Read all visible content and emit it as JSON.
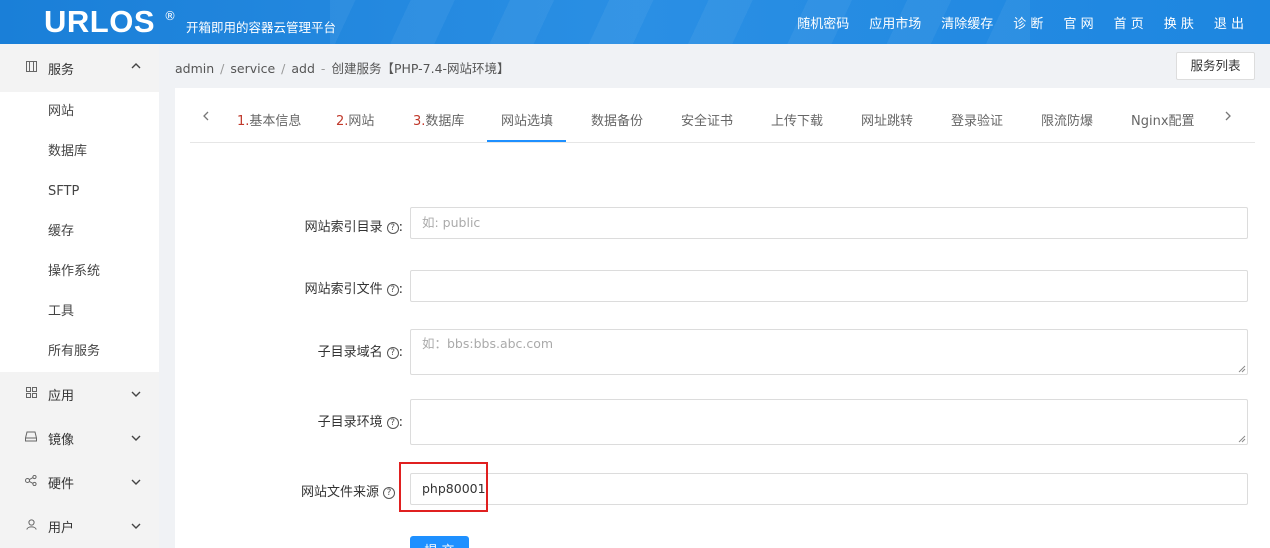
{
  "header": {
    "logo": "URLOS",
    "logo_mark": "®",
    "slogan": "开箱即用的容器云管理平台",
    "nav": [
      "随机密码",
      "应用市场",
      "清除缓存",
      "诊 断",
      "官 网",
      "首 页",
      "换 肤",
      "退 出"
    ]
  },
  "sidebar": {
    "service_group": {
      "label": "服务",
      "icon": "grid-icon",
      "expanded": true
    },
    "service_items": [
      "网站",
      "数据库",
      "SFTP",
      "缓存",
      "操作系统",
      "工具",
      "所有服务"
    ],
    "other_groups": [
      {
        "label": "应用",
        "icon": "apps-icon"
      },
      {
        "label": "镜像",
        "icon": "disk-icon"
      },
      {
        "label": "硬件",
        "icon": "share-icon"
      },
      {
        "label": "用户",
        "icon": "user-icon"
      }
    ]
  },
  "breadcrumb": {
    "parts": [
      "admin",
      "service",
      "add"
    ],
    "title": "创建服务【PHP-7.4-网站环境】"
  },
  "service_list_button": "服务列表",
  "tabs": [
    {
      "num": "1.",
      "label": "基本信息"
    },
    {
      "num": "2.",
      "label": "网站"
    },
    {
      "num": "3.",
      "label": "数据库"
    },
    {
      "num": "",
      "label": "网站选填"
    },
    {
      "num": "",
      "label": "数据备份"
    },
    {
      "num": "",
      "label": "安全证书"
    },
    {
      "num": "",
      "label": "上传下载"
    },
    {
      "num": "",
      "label": "网址跳转"
    },
    {
      "num": "",
      "label": "登录验证"
    },
    {
      "num": "",
      "label": "限流防爆"
    },
    {
      "num": "",
      "label": "Nginx配置"
    }
  ],
  "active_tab": "网站选填",
  "form": {
    "index_dir": {
      "label": "网站索引目录",
      "placeholder": "如: public",
      "value": ""
    },
    "index_file": {
      "label": "网站索引文件",
      "placeholder": "",
      "value": ""
    },
    "subdir_domain": {
      "label": "子目录域名",
      "placeholder": "如：bbs:bbs.abc.com",
      "value": ""
    },
    "subdir_env": {
      "label": "子目录环境",
      "placeholder": "",
      "value": ""
    },
    "file_source": {
      "label": "网站文件来源",
      "placeholder": "",
      "value": "php80001"
    },
    "label_suffix": ":",
    "submit": "提 交"
  },
  "colors": {
    "topbar": "#1a7fd8",
    "accent": "#1e90ff",
    "step_number": "#c0392b",
    "highlight": "#e02020"
  }
}
